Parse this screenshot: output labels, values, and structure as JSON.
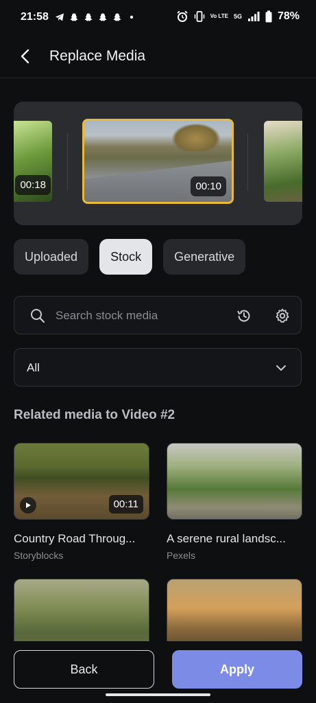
{
  "status_bar": {
    "time": "21:58",
    "battery": "78%",
    "network": "5G",
    "volte": "Vo LTE"
  },
  "header": {
    "title": "Replace Media"
  },
  "carousel": {
    "items": [
      {
        "duration": "00:18"
      },
      {
        "duration": "00:10",
        "selected": true
      },
      {
        "duration": ""
      }
    ],
    "accent": "#e9b93a"
  },
  "tabs": [
    {
      "label": "Uploaded",
      "active": false
    },
    {
      "label": "Stock",
      "active": true
    },
    {
      "label": "Generative",
      "active": false
    }
  ],
  "search": {
    "placeholder": "Search stock media",
    "value": ""
  },
  "filter": {
    "selected": "All"
  },
  "section": {
    "title": "Related media to Video #2"
  },
  "media": [
    {
      "name": "Country Road Throug...",
      "source": "Storyblocks",
      "duration": "00:11"
    },
    {
      "name": "A serene rural landsc...",
      "source": "Pexels",
      "duration": ""
    },
    {
      "name": "",
      "source": "",
      "duration": ""
    },
    {
      "name": "",
      "source": "",
      "duration": ""
    }
  ],
  "actions": {
    "back": "Back",
    "apply": "Apply",
    "apply_color": "#7b8be6"
  }
}
